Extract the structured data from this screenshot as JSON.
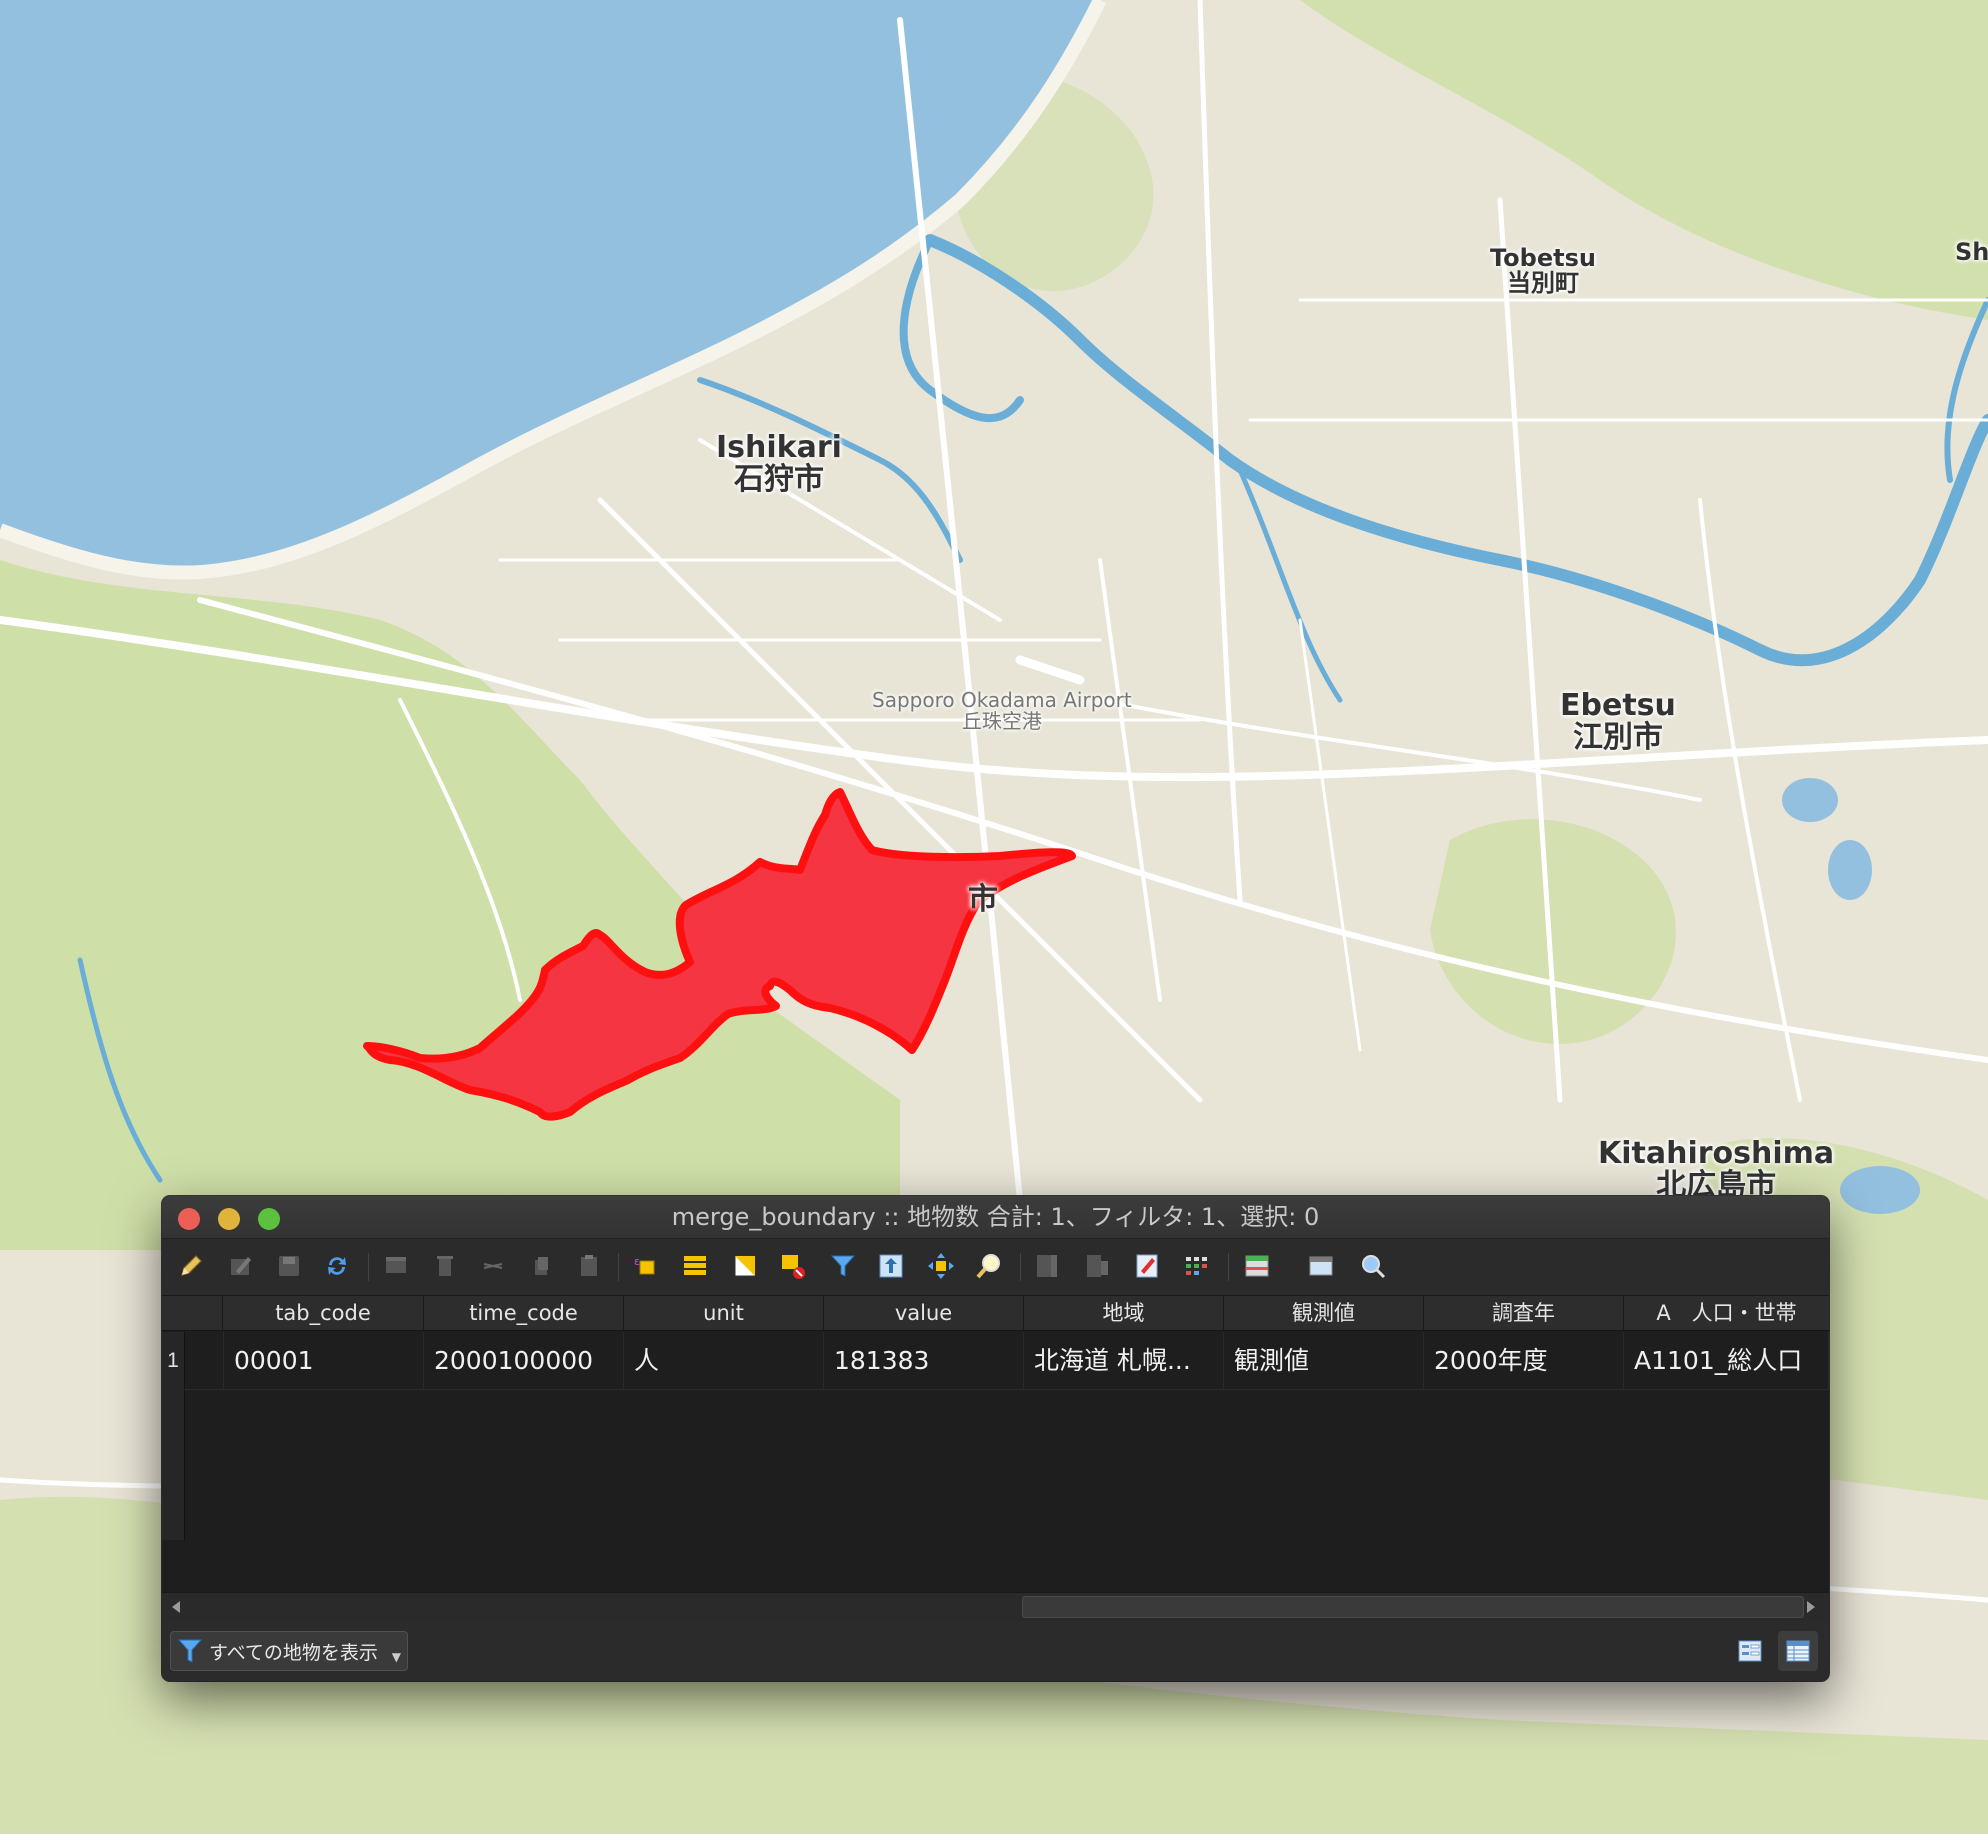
{
  "map": {
    "labels": [
      {
        "en": "Ishikari",
        "ja": "石狩市"
      },
      {
        "en": "Tobetsu",
        "ja": "当別町"
      },
      {
        "en": "Sh",
        "ja": ""
      },
      {
        "en": "Sapporo Okadama Airport",
        "ja": "丘珠空港"
      },
      {
        "en": "Ebetsu",
        "ja": "江別市"
      },
      {
        "en": "Kitahiroshima",
        "ja": "北広島市"
      },
      {
        "en": "",
        "ja": "市"
      }
    ],
    "colors": {
      "water": "#93c0df",
      "land": "#e8e4d6",
      "forest": "#cfdfa8",
      "road": "#ffffff",
      "river": "#6aaed8",
      "polygon_fill": "#f53642",
      "polygon_stroke": "#ff1010"
    }
  },
  "window": {
    "title": "merge_boundary :: 地物数 合計: 1、フィルタ: 1、選択: 0",
    "toolbar": [
      {
        "icon": "edit-pencil-icon",
        "enabled": true
      },
      {
        "icon": "multi-edit-icon",
        "enabled": false
      },
      {
        "icon": "save-edits-icon",
        "enabled": false
      },
      {
        "icon": "reload-icon",
        "enabled": true
      },
      {
        "icon": "add-feature-icon",
        "enabled": false
      },
      {
        "icon": "delete-feature-icon",
        "enabled": false
      },
      {
        "icon": "cut-icon",
        "enabled": false
      },
      {
        "icon": "copy-icon",
        "enabled": false
      },
      {
        "icon": "paste-icon",
        "enabled": false
      },
      {
        "icon": "select-by-expression-icon",
        "enabled": true
      },
      {
        "icon": "select-all-icon",
        "enabled": true
      },
      {
        "icon": "invert-selection-icon",
        "enabled": true
      },
      {
        "icon": "deselect-all-icon",
        "enabled": true
      },
      {
        "icon": "filter-icon",
        "enabled": true
      },
      {
        "icon": "move-selection-to-top-icon",
        "enabled": true
      },
      {
        "icon": "pan-to-selected-icon",
        "enabled": true
      },
      {
        "icon": "zoom-to-selected-icon",
        "enabled": true
      },
      {
        "icon": "new-field-icon",
        "enabled": false
      },
      {
        "icon": "delete-field-icon",
        "enabled": false
      },
      {
        "icon": "field-calculator-icon",
        "enabled": true
      },
      {
        "icon": "conditional-formatting-icon",
        "enabled": true
      },
      {
        "icon": "dock-table-icon",
        "enabled": true
      },
      {
        "icon": "actions-icon",
        "enabled": true
      },
      {
        "icon": "zoom-map-icon",
        "enabled": true
      }
    ]
  },
  "table": {
    "columns": [
      "tab_code",
      "time_code",
      "unit",
      "value",
      "地域",
      "観測値",
      "調査年",
      "A　人口・世帯"
    ],
    "rows": [
      {
        "num": "1",
        "cells": [
          "00001",
          "2000100000",
          "人",
          "181383",
          "北海道 札幌...",
          "観測値",
          "2000年度",
          "A1101_総人口"
        ]
      }
    ]
  },
  "status": {
    "filter_label": "すべての地物を表示",
    "views": [
      "form-view-icon",
      "table-view-icon"
    ],
    "active_view": "table-view-icon"
  }
}
